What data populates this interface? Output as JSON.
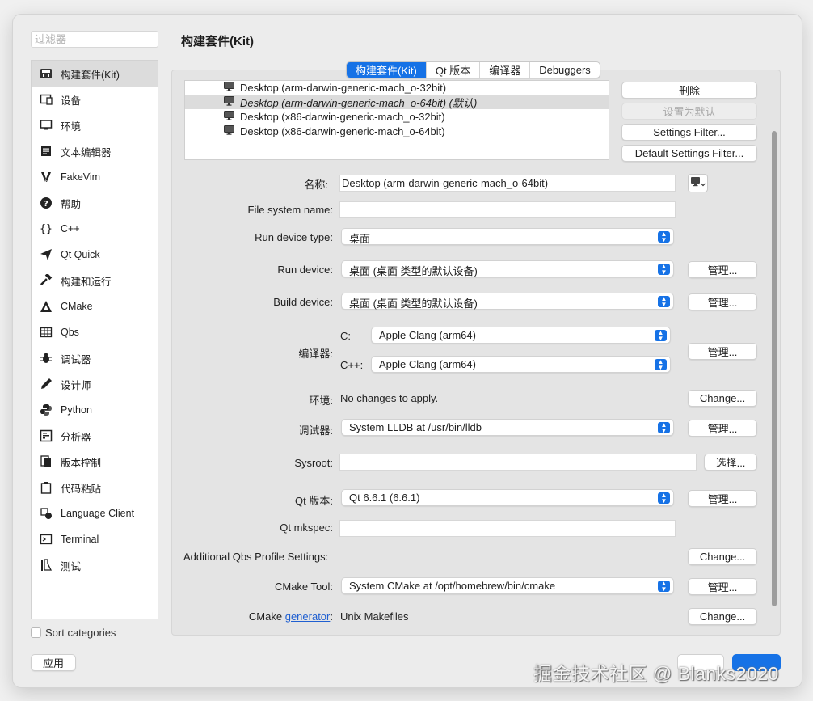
{
  "filter": {
    "placeholder": "过滤器"
  },
  "page": {
    "title": "构建套件(Kit)"
  },
  "sidebar": {
    "items": [
      {
        "label": "构建套件(Kit)",
        "icon": "kit-icon"
      },
      {
        "label": "设备",
        "icon": "device-icon"
      },
      {
        "label": "环境",
        "icon": "monitor-icon"
      },
      {
        "label": "文本编辑器",
        "icon": "text-editor-icon"
      },
      {
        "label": "FakeVim",
        "icon": "fakevim-icon"
      },
      {
        "label": "帮助",
        "icon": "help-icon"
      },
      {
        "label": "C++",
        "icon": "braces-icon"
      },
      {
        "label": "Qt Quick",
        "icon": "paper-plane-icon"
      },
      {
        "label": "构建和运行",
        "icon": "hammer-icon"
      },
      {
        "label": "CMake",
        "icon": "cmake-icon"
      },
      {
        "label": "Qbs",
        "icon": "grid-icon"
      },
      {
        "label": "调试器",
        "icon": "bug-icon"
      },
      {
        "label": "设计师",
        "icon": "pen-icon"
      },
      {
        "label": "Python",
        "icon": "python-icon"
      },
      {
        "label": "分析器",
        "icon": "analyzer-icon"
      },
      {
        "label": "版本控制",
        "icon": "version-control-icon"
      },
      {
        "label": "代码粘贴",
        "icon": "clipboard-icon"
      },
      {
        "label": "Language Client",
        "icon": "language-client-icon"
      },
      {
        "label": "Terminal",
        "icon": "terminal-icon"
      },
      {
        "label": "测试",
        "icon": "test-flask-icon"
      }
    ],
    "sort_label": "Sort categories",
    "apply_label": "应用"
  },
  "tabs": [
    "构建套件(Kit)",
    "Qt 版本",
    "编译器",
    "Debuggers"
  ],
  "kits": [
    "Desktop (arm-darwin-generic-mach_o-32bit)",
    "Desktop (arm-darwin-generic-mach_o-64bit) (默认)",
    "Desktop (x86-darwin-generic-mach_o-32bit)",
    "Desktop (x86-darwin-generic-mach_o-64bit)"
  ],
  "kit_buttons": {
    "delete": "删除",
    "set_default": "设置为默认",
    "settings_filter": "Settings Filter...",
    "default_settings_filter": "Default Settings Filter..."
  },
  "form": {
    "name_label": "名称:",
    "name_value": "Desktop (arm-darwin-generic-mach_o-64bit)",
    "fs_label": "File system name:",
    "run_type_label": "Run device type:",
    "run_type_value": "桌面",
    "run_device_label": "Run device:",
    "run_device_value": "桌面 (桌面 类型的默认设备)",
    "build_device_label": "Build device:",
    "build_device_value": "桌面 (桌面 类型的默认设备)",
    "compiler_label": "编译器:",
    "c_label": "C:",
    "c_value": "Apple Clang (arm64)",
    "cpp_label": "C++:",
    "cpp_value": "Apple Clang (arm64)",
    "env_label": "环境:",
    "env_value": "No changes to apply.",
    "debugger_label": "调试器:",
    "debugger_value": "System LLDB at /usr/bin/lldb",
    "sysroot_label": "Sysroot:",
    "qt_version_label": "Qt 版本:",
    "qt_version_value": "Qt 6.6.1 (6.6.1)",
    "mkspec_label": "Qt mkspec:",
    "qbs_label": "Additional Qbs Profile Settings:",
    "cmake_tool_label": "CMake Tool:",
    "cmake_tool_value": "System CMake at /opt/homebrew/bin/cmake",
    "cmake_gen_prefix": "CMake ",
    "cmake_gen_link": "generator",
    "cmake_gen_suffix": ":",
    "cmake_gen_value": "Unix Makefiles"
  },
  "buttons": {
    "manage": "管理...",
    "change": "Change...",
    "choose": "选择..."
  },
  "watermark": "掘金技术社区 @ Blanks2020",
  "colors": {
    "accent": "#1672e6"
  }
}
